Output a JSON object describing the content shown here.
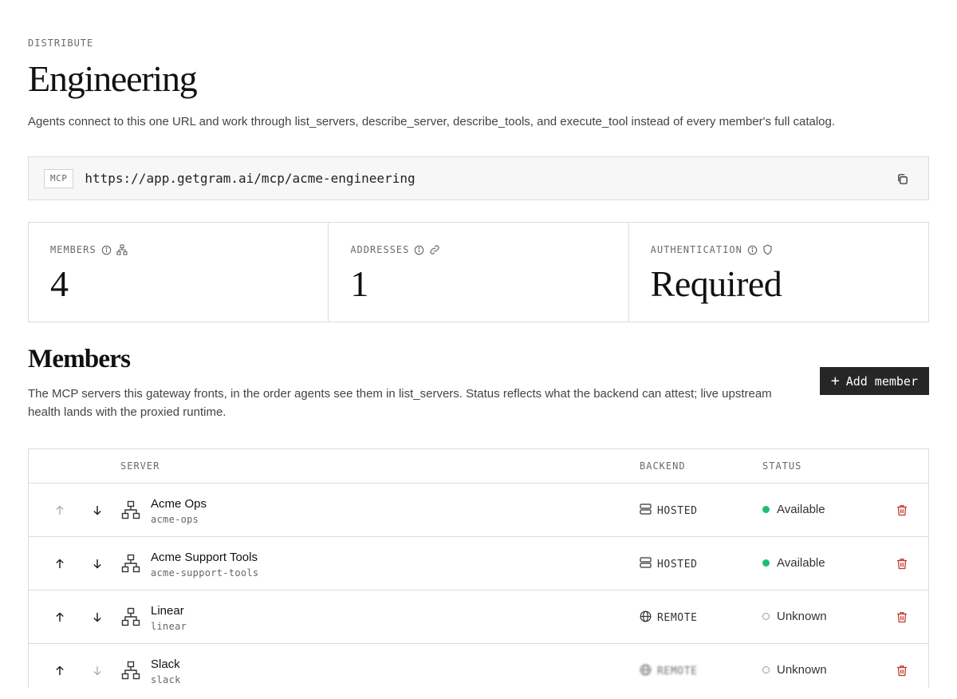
{
  "header": {
    "eyebrow": "DISTRIBUTE",
    "title": "Engineering",
    "description": "Agents connect to this one URL and work through list_servers, describe_server, describe_tools, and execute_tool instead of every member's full catalog."
  },
  "endpoint": {
    "badge": "MCP",
    "url": "https://app.getgram.ai/mcp/acme-engineering",
    "copy_icon": "copy-icon"
  },
  "stats": [
    {
      "label": "MEMBERS",
      "value": "4",
      "icon": "network-icon"
    },
    {
      "label": "ADDRESSES",
      "value": "1",
      "icon": "link-icon"
    },
    {
      "label": "AUTHENTICATION",
      "value": "Required",
      "icon": "shield-icon"
    }
  ],
  "members": {
    "title": "Members",
    "description": "The MCP servers this gateway fronts, in the order agents see them in list_servers. Status reflects what the backend can attest; live upstream health lands with the proxied runtime.",
    "add_label": "Add member",
    "columns": {
      "server": "SERVER",
      "backend": "BACKEND",
      "status": "STATUS"
    },
    "rows": [
      {
        "name": "Acme Ops",
        "slug": "acme-ops",
        "backend": "HOSTED",
        "status": "Available",
        "online": true
      },
      {
        "name": "Acme Support Tools",
        "slug": "acme-support-tools",
        "backend": "HOSTED",
        "status": "Available",
        "online": true
      },
      {
        "name": "Linear",
        "slug": "linear",
        "backend": "REMOTE",
        "status": "Unknown",
        "online": false
      },
      {
        "name": "Slack",
        "slug": "slack",
        "backend": "REMOTE",
        "status": "Unknown",
        "online": false
      }
    ]
  },
  "colors": {
    "available": "#1dbf6e",
    "danger": "#c0392b",
    "button": "#262626"
  }
}
